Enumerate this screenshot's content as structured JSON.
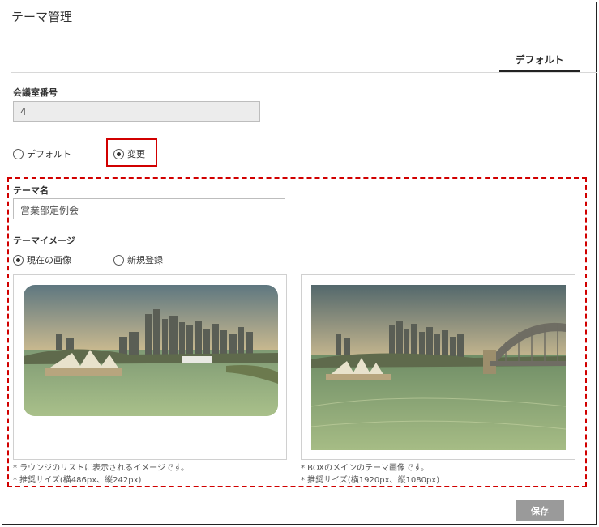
{
  "page": {
    "title": "テーマ管理"
  },
  "tabs": [
    {
      "label": "デフォルト",
      "active": true
    }
  ],
  "room": {
    "label": "会議室番号",
    "value": "4"
  },
  "theme_mode": {
    "options": [
      {
        "label": "デフォルト",
        "selected": false
      },
      {
        "label": "変更",
        "selected": true
      }
    ]
  },
  "theme": {
    "name_label": "テーマ名",
    "name_value": "営業部定例会",
    "image_label": "テーマイメージ",
    "image_options": [
      {
        "label": "現在の画像",
        "selected": true
      },
      {
        "label": "新規登録",
        "selected": false
      }
    ],
    "left_notes": [
      "* ラウンジのリストに表示されるイメージです。",
      "* 推奨サイズ(横486px、縦242px)"
    ],
    "right_notes": [
      "* BOXのメインのテーマ画像です。",
      "* 推奨サイズ(横1920px、縦1080px)"
    ]
  },
  "actions": {
    "save_label": "保存"
  },
  "colors": {
    "highlight": "#d10000",
    "button": "#9a9a9a"
  }
}
